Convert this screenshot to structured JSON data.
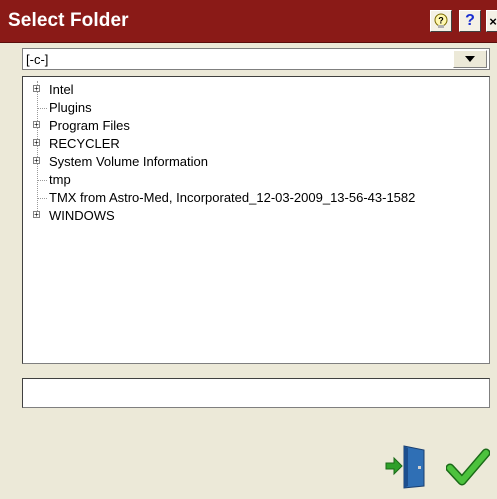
{
  "window": {
    "title": "Select Folder",
    "buttons": {
      "help1": "?",
      "help2": "?",
      "close": "×"
    }
  },
  "drive": {
    "selected": "[-c-]"
  },
  "tree": {
    "items": [
      {
        "label": "Intel",
        "expandable": true
      },
      {
        "label": "Plugins",
        "expandable": false
      },
      {
        "label": "Program Files",
        "expandable": true
      },
      {
        "label": "RECYCLER",
        "expandable": true
      },
      {
        "label": "System Volume Information",
        "expandable": true
      },
      {
        "label": "tmp",
        "expandable": false
      },
      {
        "label": "TMX from Astro-Med, Incorporated_12-03-2009_13-56-43-1582",
        "expandable": false
      },
      {
        "label": "WINDOWS",
        "expandable": true
      }
    ]
  },
  "path_field": {
    "value": ""
  },
  "actions": {
    "exit_icon": "exit-door-icon",
    "ok_icon": "checkmark-icon"
  },
  "colors": {
    "titlebar": "#8a1a17",
    "background": "#ece9d8",
    "accent_green": "#2fa02a",
    "door_blue": "#2f6fb5"
  }
}
